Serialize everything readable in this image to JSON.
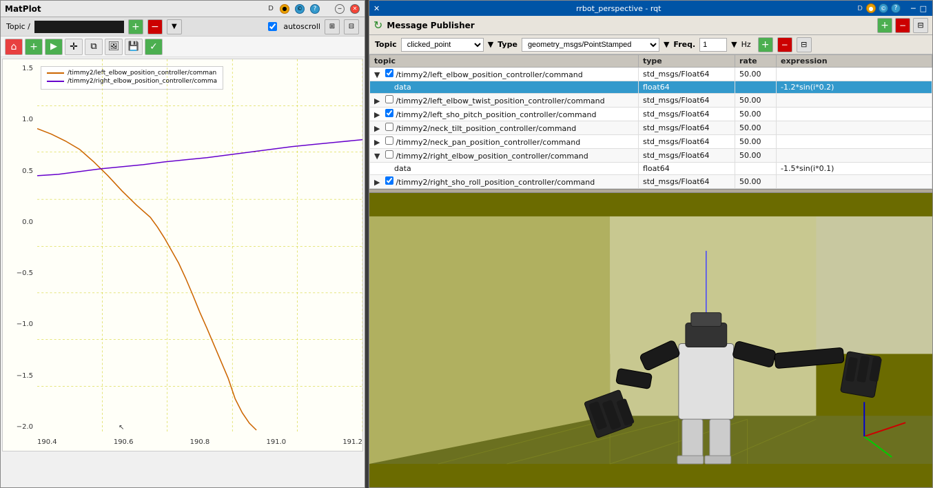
{
  "matplot": {
    "title": "MatPlot",
    "topic_label": "Topic /",
    "topic_value": "",
    "autoscroll_label": "autoscroll",
    "titlebar_buttons": [
      "D",
      "●",
      "©",
      "?",
      "-",
      "✕"
    ],
    "legend": {
      "line1": "/timmy2/left_elbow_position_controller/comman",
      "line2": "/timmy2/right_elbow_position_controller/comma",
      "line1_color": "#cc6600",
      "line2_color": "#6600cc"
    },
    "yaxis": [
      "1.5",
      "1.0",
      "0.5",
      "0.0",
      "-0.5",
      "-1.0",
      "-1.5",
      "-2.0"
    ],
    "xaxis": [
      "190.4",
      "190.6",
      "190.8",
      "191.0",
      "191.2"
    ]
  },
  "rqt": {
    "title": "rrbot_perspective - rqt",
    "titlebar_btns": [
      "✕",
      "─",
      "□"
    ],
    "msg_publisher": {
      "label": "Message Publisher",
      "topic_label": "Topic",
      "topic_value": "clicked_point",
      "type_label": "Type",
      "type_value": "geometry_msgs/PointStamped",
      "freq_label": "Freq.",
      "freq_value": "1",
      "hz_label": "Hz"
    },
    "table": {
      "headers": [
        "topic",
        "type",
        "rate",
        "expression"
      ],
      "rows": [
        {
          "id": "row1",
          "expand": "▼",
          "checked": true,
          "topic": "/timmy2/left_elbow_position_controller/command",
          "type": "std_msgs/Float64",
          "rate": "50.00",
          "expression": "",
          "selected": false,
          "indent": 0
        },
        {
          "id": "row1a",
          "expand": "",
          "checked": false,
          "topic": "data",
          "type": "float64",
          "rate": "",
          "expression": "-1.2*sin(i*0.2)",
          "selected": true,
          "indent": 1
        },
        {
          "id": "row2",
          "expand": "▶",
          "checked": false,
          "topic": "/timmy2/left_elbow_twist_position_controller/command",
          "type": "std_msgs/Float64",
          "rate": "50.00",
          "expression": "",
          "selected": false,
          "indent": 0
        },
        {
          "id": "row3",
          "expand": "▶",
          "checked": true,
          "topic": "/timmy2/left_sho_pitch_position_controller/command",
          "type": "std_msgs/Float64",
          "rate": "50.00",
          "expression": "",
          "selected": false,
          "indent": 0
        },
        {
          "id": "row4",
          "expand": "▶",
          "checked": false,
          "topic": "/timmy2/neck_tilt_position_controller/command",
          "type": "std_msgs/Float64",
          "rate": "50.00",
          "expression": "",
          "selected": false,
          "indent": 0
        },
        {
          "id": "row5",
          "expand": "▶",
          "checked": false,
          "topic": "/timmy2/neck_pan_position_controller/command",
          "type": "std_msgs/Float64",
          "rate": "50.00",
          "expression": "",
          "selected": false,
          "indent": 0
        },
        {
          "id": "row6",
          "expand": "▼",
          "checked": false,
          "topic": "/timmy2/right_elbow_position_controller/command",
          "type": "std_msgs/Float64",
          "rate": "50.00",
          "expression": "",
          "selected": false,
          "indent": 0
        },
        {
          "id": "row6a",
          "expand": "",
          "checked": false,
          "topic": "data",
          "type": "float64",
          "rate": "",
          "expression": "-1.5*sin(i*0.1)",
          "selected": false,
          "indent": 1
        },
        {
          "id": "row7",
          "expand": "▶",
          "checked": true,
          "topic": "/timmy2/right_sho_roll_position_controller/command",
          "type": "std_msgs/Float64",
          "rate": "50.00",
          "expression": "",
          "selected": false,
          "indent": 0
        }
      ]
    }
  }
}
